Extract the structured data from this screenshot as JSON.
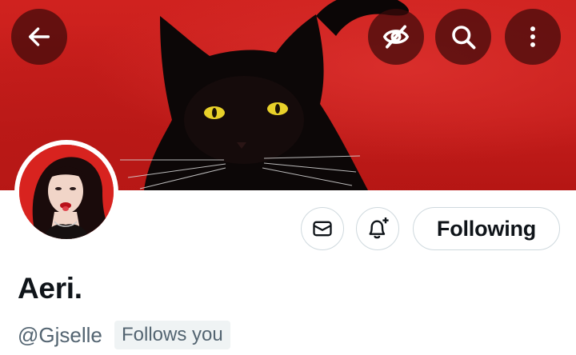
{
  "header": {
    "back_icon": "arrow-left-icon",
    "hide_icon": "eye-slash-icon",
    "search_icon": "search-icon",
    "more_icon": "more-vertical-icon",
    "banner_color": "#c41d1b"
  },
  "actions": {
    "message_icon": "envelope-icon",
    "notify_icon": "bell-plus-icon",
    "following_label": "Following"
  },
  "profile": {
    "display_name": "Aeri.",
    "handle": "@Gjselle",
    "follows_you": "Follows you"
  },
  "colors": {
    "text_primary": "#0f1419",
    "text_secondary": "#536471",
    "border": "#cfd9de",
    "badge_bg": "#eff3f4"
  }
}
